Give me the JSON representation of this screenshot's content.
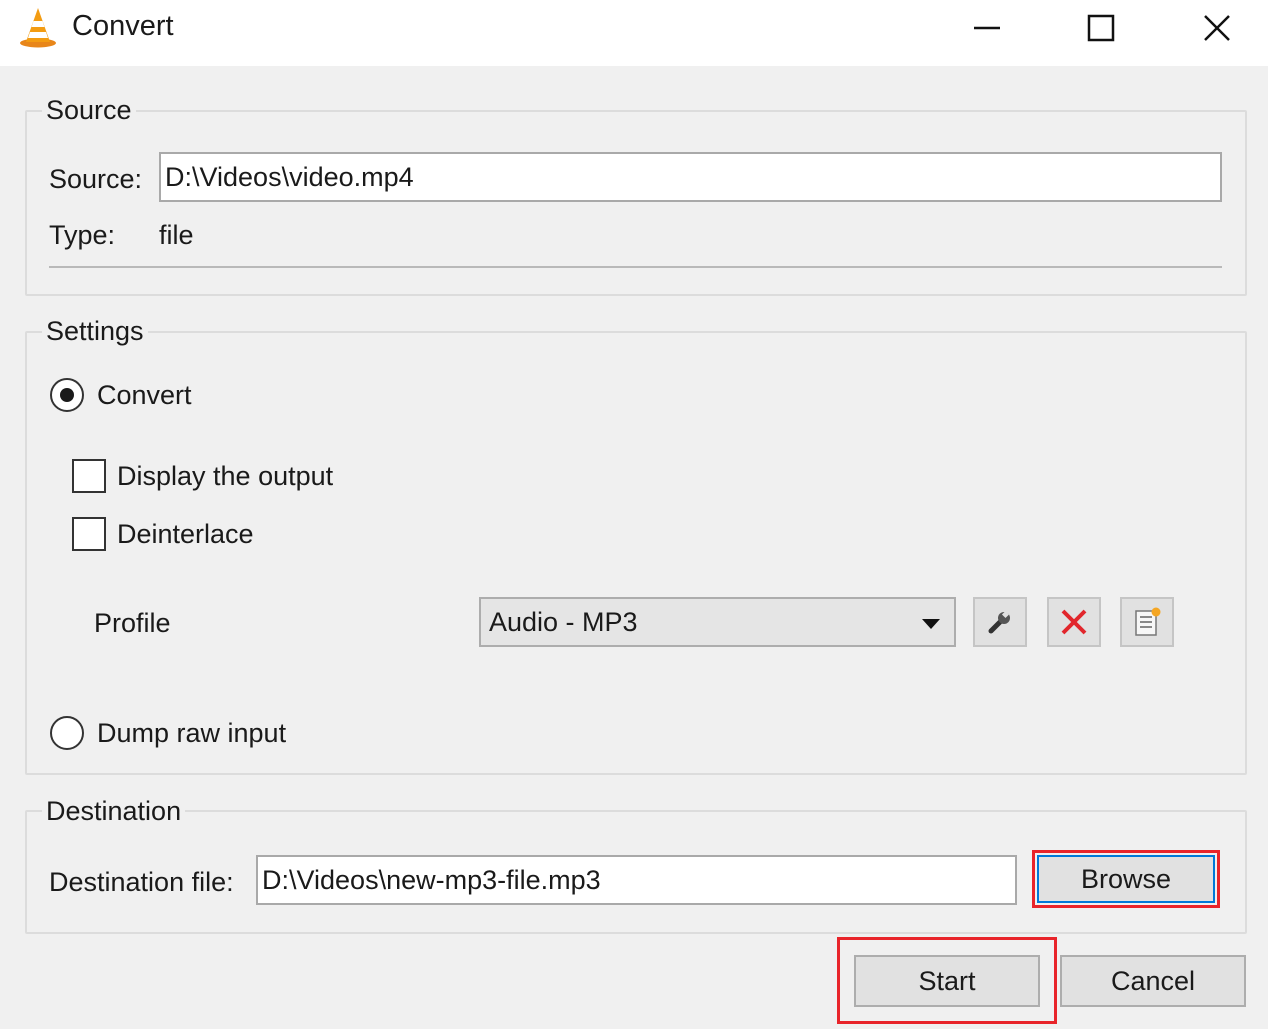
{
  "window": {
    "title": "Convert",
    "icon": "vlc-cone-icon",
    "controls": {
      "minimize": "minimize-icon",
      "maximize": "maximize-icon",
      "close": "close-icon"
    }
  },
  "source_group": {
    "legend": "Source",
    "source_label": "Source:",
    "source_value": "D:\\Videos\\video.mp4",
    "type_label": "Type:",
    "type_value": "file"
  },
  "settings_group": {
    "legend": "Settings",
    "convert_label": "Convert",
    "convert_selected": true,
    "display_output_label": "Display the output",
    "display_output_checked": false,
    "deinterlace_label": "Deinterlace",
    "deinterlace_checked": false,
    "profile_label": "Profile",
    "profile_selected": "Audio - MP3",
    "profile_buttons": [
      "wrench-icon",
      "red-x-delete-icon",
      "new-profile-icon"
    ],
    "dump_raw_label": "Dump raw input",
    "dump_raw_selected": false
  },
  "destination_group": {
    "legend": "Destination",
    "dest_label": "Destination file:",
    "dest_value": "D:\\Videos\\new-mp3-file.mp3",
    "browse_label": "Browse"
  },
  "actions": {
    "start_label": "Start",
    "cancel_label": "Cancel"
  },
  "colors": {
    "highlight": "#e8242a",
    "focus": "#0078d7",
    "delete_icon": "#e1262c"
  }
}
